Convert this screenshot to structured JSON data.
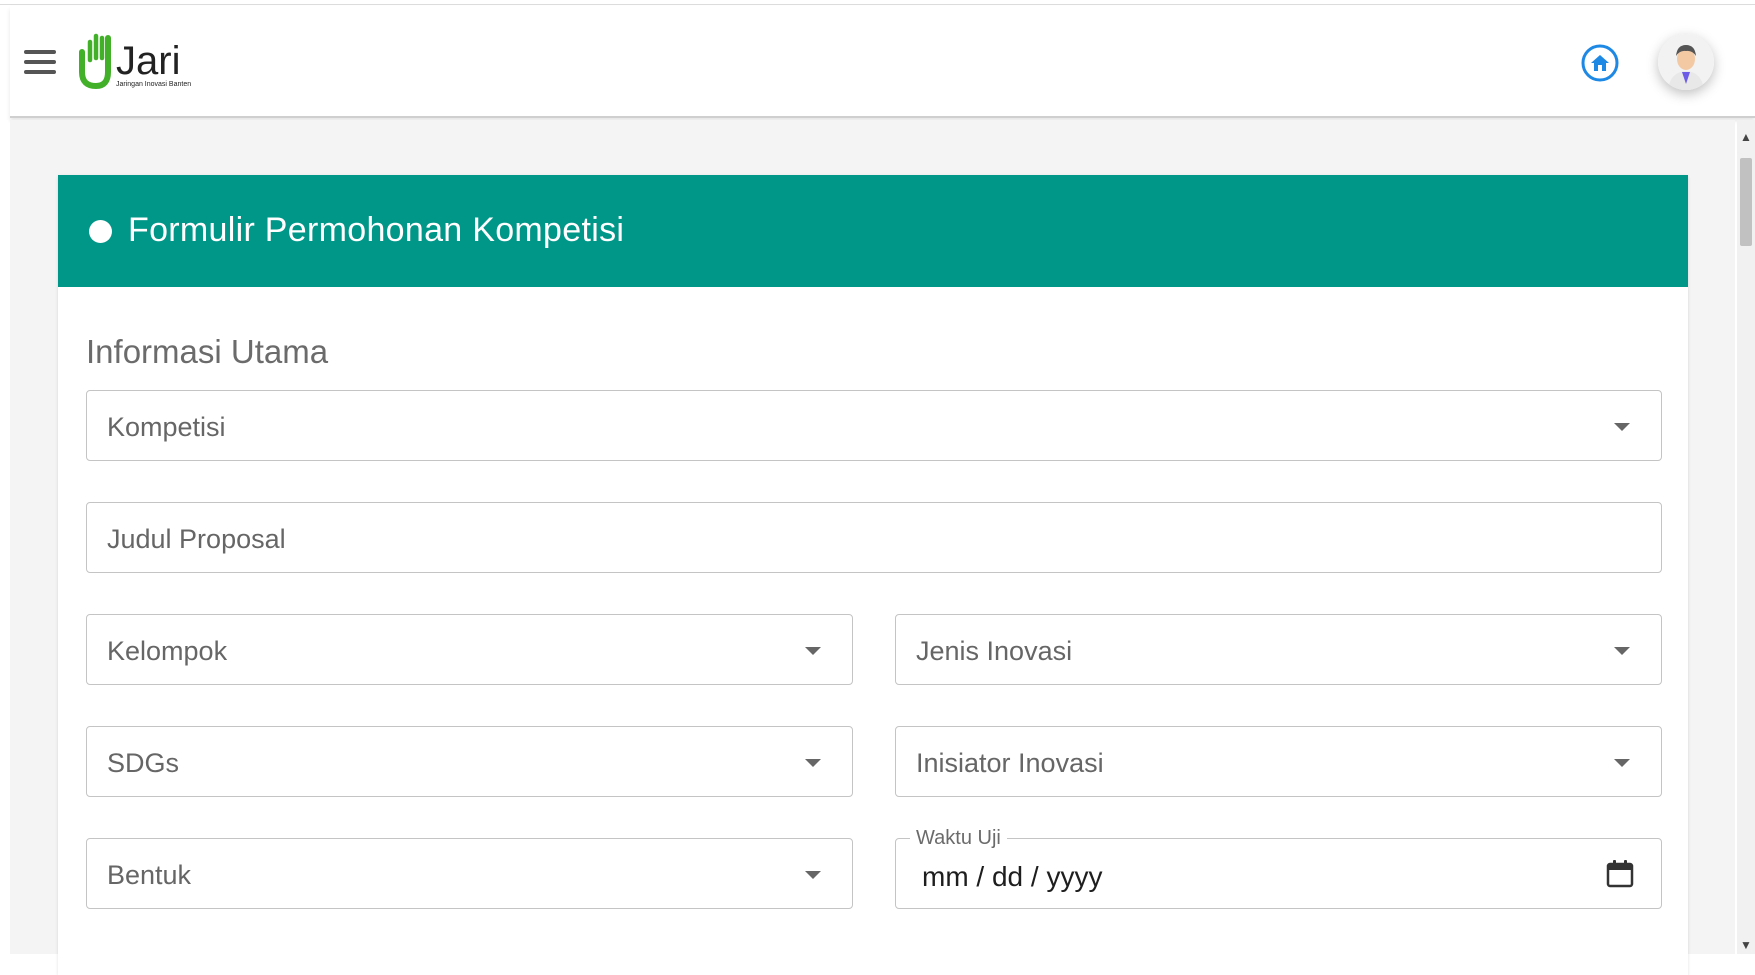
{
  "header": {
    "logo_text": "Jari",
    "logo_tagline": "Jaringan Inovasi Banten",
    "colors": {
      "logo_green": "#43b02a",
      "logo_dark": "#222222",
      "home_icon": "#1e88e5"
    }
  },
  "form": {
    "title": "Formulir Permohonan Kompetisi",
    "header_color": "#009688",
    "section_title": "Informasi Utama",
    "fields": {
      "kompetisi": "Kompetisi",
      "judul_proposal": "Judul Proposal",
      "kelompok": "Kelompok",
      "jenis_inovasi": "Jenis Inovasi",
      "sdgs": "SDGs",
      "inisiator_inovasi": "Inisiator Inovasi",
      "bentuk": "Bentuk",
      "waktu_uji_label": "Waktu Uji",
      "waktu_uji_placeholder": "mm / dd / yyyy"
    }
  },
  "icons": [
    "menu-icon",
    "home-icon",
    "user-avatar",
    "calendar-icon",
    "chevron-down-icon"
  ]
}
